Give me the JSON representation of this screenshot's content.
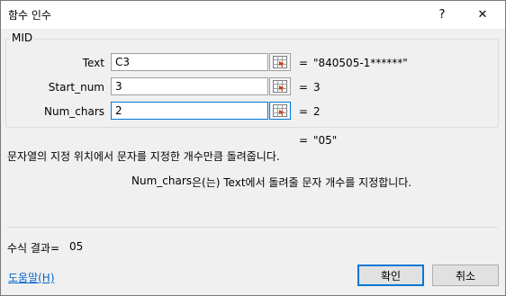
{
  "window": {
    "title": "함수 인수",
    "help": "?",
    "close": "✕"
  },
  "function": {
    "name": "MID",
    "args": [
      {
        "label": "Text",
        "value": "C3",
        "result": "\"840505-1******\""
      },
      {
        "label": "Start_num",
        "value": "3",
        "result": "3"
      },
      {
        "label": "Num_chars",
        "value": "2",
        "result": "2"
      }
    ],
    "eq": "=",
    "overall_result": "\"05\"",
    "description": "문자열의 지정 위치에서 문자를 지정한 개수만큼 돌려줍니다.",
    "arg_help_name": "Num_chars",
    "arg_help_text": "은(는) Text에서 돌려줄 문자 개수를 지정합니다."
  },
  "formula_result": {
    "label": "수식 결과=",
    "value": "05"
  },
  "help_link": "도움말(H)",
  "buttons": {
    "ok": "확인",
    "cancel": "취소"
  },
  "colors": {
    "accent": "#0078d7",
    "link": "#0066cc",
    "ref_icon_red": "#d83b01"
  }
}
